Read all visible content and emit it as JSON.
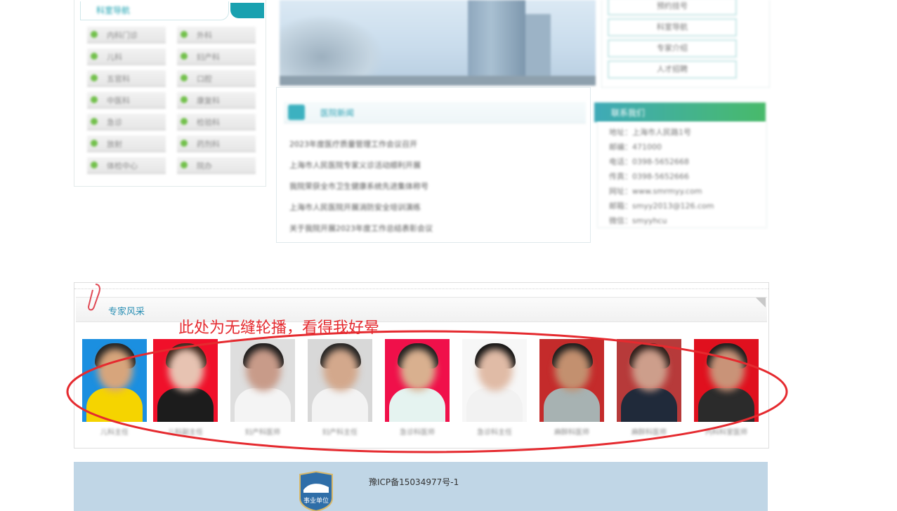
{
  "departments": {
    "title": "科室导航",
    "items": [
      "内科门诊",
      "外科",
      "儿科",
      "妇产科",
      "五官科",
      "口腔",
      "中医科",
      "康复科",
      "急诊",
      "检验科",
      "放射",
      "药剂科",
      "体检中心",
      "院办"
    ]
  },
  "news": {
    "title": "医院新闻",
    "items": [
      "2023年度医疗质量管理工作会议召开",
      "上海市人民医院专家义诊活动顺利开展",
      "我院荣获全市卫生健康系统先进集体称号",
      "上海市人民医院开展消防安全培训演练",
      "关于我院开展2023年度工作总结表彰会议"
    ]
  },
  "right_buttons": [
    "预约挂号",
    "科室导航",
    "专家介绍",
    "人才招聘"
  ],
  "contact": {
    "title": "联系我们",
    "lines": [
      "地址：上海市人民路1号",
      "邮编：471000",
      "电话：0398-5652668",
      "传真：0398-5652666",
      "网址：www.smrmyy.com",
      "邮箱：smyy2013@126.com",
      "微信：smyyhcu"
    ]
  },
  "experts": {
    "title": "专家风采",
    "items": [
      {
        "name": "儿科主任",
        "bg": "#1b8fe0",
        "shirt": "#f5d400",
        "skin": "#d7a57c",
        "hair": "#222"
      },
      {
        "name": "儿科副主任",
        "bg": "#f0102a",
        "shirt": "#1c1c1c",
        "skin": "#e7c3b2",
        "hair": "#3a2318"
      },
      {
        "name": "妇产科医师",
        "bg": "#dedede",
        "shirt": "#f4f4f4",
        "skin": "#c89b89",
        "hair": "#1b1b1b"
      },
      {
        "name": "妇产科主任",
        "bg": "#d8d8d8",
        "shirt": "#f3f3f3",
        "skin": "#d3a88c",
        "hair": "#222"
      },
      {
        "name": "急诊科医师",
        "bg": "#f0104a",
        "shirt": "#e5f3f0",
        "skin": "#d9b08f",
        "hair": "#1d1d1d"
      },
      {
        "name": "急诊科主任",
        "bg": "#f7f7f7",
        "shirt": "#f2f2f2",
        "skin": "#e0bba6",
        "hair": "#111"
      },
      {
        "name": "麻醉科医师",
        "bg": "#c42b2b",
        "shirt": "#a7b2b2",
        "skin": "#c3906f",
        "hair": "#1b1b1b"
      },
      {
        "name": "麻醉科医师",
        "bg": "#b73a3a",
        "shirt": "#202a3a",
        "skin": "#cd9e8b",
        "hair": "#2b1c18"
      },
      {
        "name": "内科科室医师",
        "bg": "#e0101e",
        "shirt": "#2b2b2b",
        "skin": "#c99378",
        "hair": "#1a1a1a"
      }
    ]
  },
  "annotation": "此处为无缝轮播，看得我好晕",
  "footer": {
    "badge_text": "事业单位",
    "icp": "豫ICP备15034977号-1"
  },
  "colors": {
    "accent": "#19a1b0",
    "annotation": "#e52a2f",
    "footer_bg": "#c0d6e6"
  }
}
